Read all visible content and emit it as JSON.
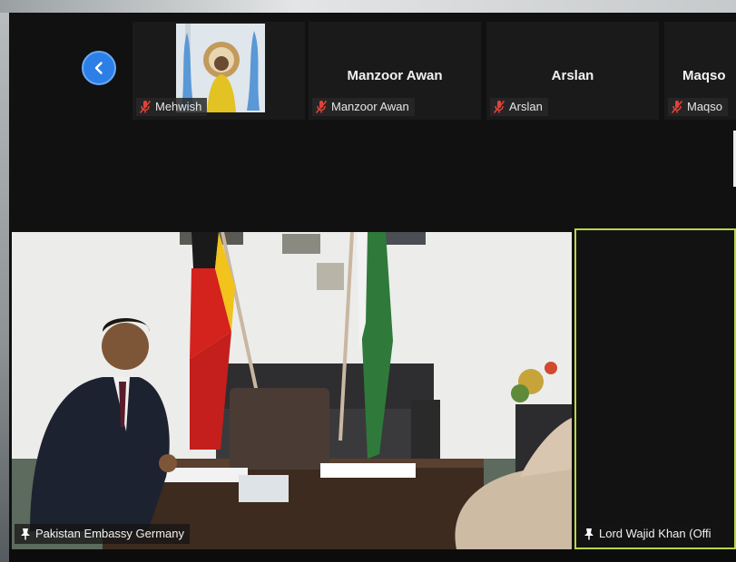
{
  "filmstrip": {
    "prev_icon": "chevron-left-icon",
    "participants": [
      {
        "label": "Mehwish",
        "display_name": "",
        "muted": true,
        "has_video": true
      },
      {
        "label": "Manzoor Awan",
        "display_name": "Manzoor Awan",
        "muted": true,
        "has_video": false
      },
      {
        "label": "Arslan",
        "display_name": "Arslan",
        "muted": true,
        "has_video": false
      },
      {
        "label": "Maqso",
        "display_name": "Maqso",
        "muted": true,
        "has_video": false
      }
    ]
  },
  "main_video": {
    "label": "Pakistan Embassy Germany",
    "pinned": true
  },
  "active_speaker": {
    "label": "Lord Wajid Khan (Offi",
    "pinned": true,
    "highlight_color": "#b9d64a"
  },
  "colors": {
    "background": "#111111",
    "accent": "#2d7fe8",
    "muted_icon": "#e0433a"
  }
}
